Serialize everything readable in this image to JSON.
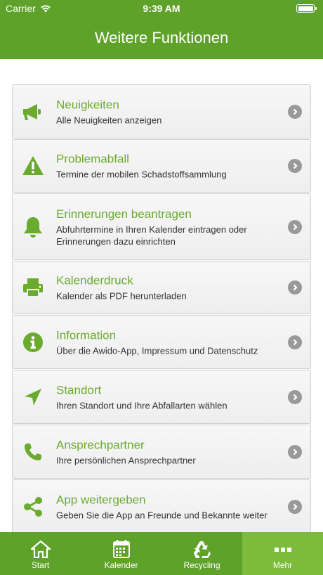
{
  "status": {
    "carrier": "Carrier",
    "time": "9:39 AM"
  },
  "header": {
    "title": "Weitere Funktionen"
  },
  "menu": [
    {
      "title": "Neuigkeiten",
      "subtitle": "Alle Neuigkeiten anzeigen",
      "icon": "megaphone-icon"
    },
    {
      "title": "Problemabfall",
      "subtitle": "Termine der mobilen Schadstoffsammlung",
      "icon": "warning-icon"
    },
    {
      "title": "Erinnerungen beantragen",
      "subtitle": "Abfuhrtermine in Ihren Kalender eintragen oder Erinnerungen dazu einrichten",
      "icon": "bell-icon"
    },
    {
      "title": "Kalenderdruck",
      "subtitle": "Kalender als PDF herunterladen",
      "icon": "printer-icon"
    },
    {
      "title": "Information",
      "subtitle": "Über die Awido-App, Impressum und Datenschutz",
      "icon": "info-icon"
    },
    {
      "title": "Standort",
      "subtitle": "Ihren Standort und Ihre Abfallarten wählen",
      "icon": "location-arrow-icon"
    },
    {
      "title": "Ansprechpartner",
      "subtitle": "Ihre persönlichen Ansprechpartner",
      "icon": "phone-icon"
    },
    {
      "title": "App weitergeben",
      "subtitle": "Geben Sie die App an Freunde und Bekannte weiter",
      "icon": "share-icon"
    }
  ],
  "tabs": [
    {
      "label": "Start",
      "icon": "home-icon"
    },
    {
      "label": "Kalender",
      "icon": "calendar-icon"
    },
    {
      "label": "Recycling",
      "icon": "recycle-icon"
    },
    {
      "label": "Mehr",
      "icon": "more-icon",
      "active": true
    }
  ],
  "colors": {
    "brand": "#5fa22a",
    "brand_active": "#7dbb3d",
    "title_green": "#6aaa2e"
  }
}
